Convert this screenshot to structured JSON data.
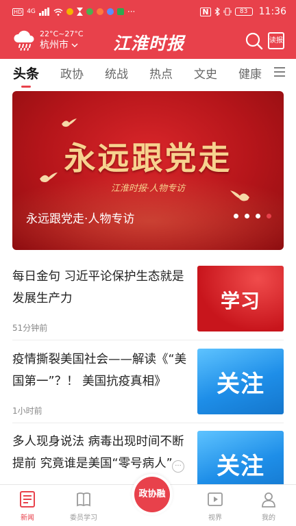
{
  "colors": {
    "brand": "#e8414b",
    "text": "#222222",
    "muted": "#888888"
  },
  "status_bar": {
    "network_chip": "HD",
    "network_type": "4G",
    "battery": "83",
    "time": "11:36",
    "more": "···"
  },
  "header": {
    "weather_temp": "22°C~27°C",
    "city": "杭州市",
    "logo_text": "江淮时报",
    "read_label": "读报",
    "icons": [
      "cloud-rain-icon",
      "search-icon",
      "newspaper-icon"
    ]
  },
  "tabs": [
    {
      "label": "头条",
      "active": true
    },
    {
      "label": "政协"
    },
    {
      "label": "统战"
    },
    {
      "label": "热点"
    },
    {
      "label": "文史"
    },
    {
      "label": "健康"
    }
  ],
  "banner": {
    "headline": "永远跟党走",
    "subtitle": "江淮时报·人物专访",
    "caption": "永远跟党走·人物专访",
    "slide_count": 4,
    "active_slide": 4
  },
  "news": [
    {
      "title": "每日金句 习近平论保护生态就是发展生产力",
      "time": "51分钟前",
      "thumb_text": "学习",
      "thumb_style": "red"
    },
    {
      "title": "疫情撕裂美国社会——解读《“美国第一”？！ 美国抗疫真相》",
      "time": "1小时前",
      "thumb_text": "关注",
      "thumb_style": "blue"
    },
    {
      "title": "多人现身说法 病毒出现时间不断提前 究竟谁是美国“零号病人”",
      "time": "",
      "thumb_text": "关注",
      "thumb_style": "blue"
    }
  ],
  "more_button": "···",
  "bottom_nav": [
    {
      "label": "新闻",
      "icon": "news-icon",
      "active": true
    },
    {
      "label": "委员学习",
      "icon": "book-icon"
    },
    {
      "label": "政协融",
      "icon": "center-brand-button"
    },
    {
      "label": "视界",
      "icon": "video-icon"
    },
    {
      "label": "我的",
      "icon": "profile-icon"
    }
  ]
}
